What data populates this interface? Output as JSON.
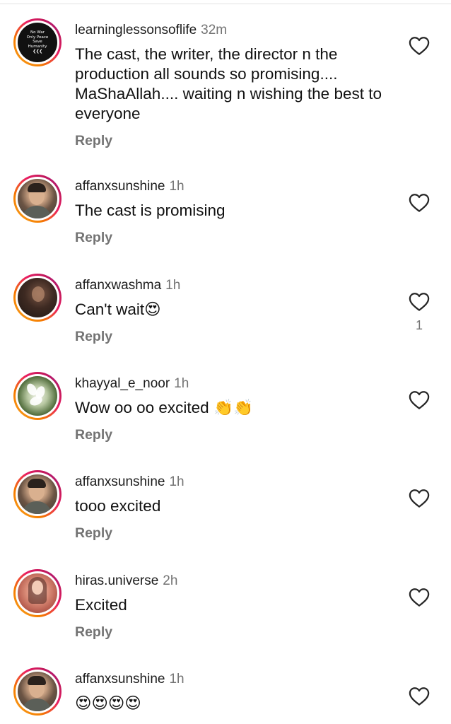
{
  "comments": [
    {
      "username": "learninglessonsoflife",
      "time": "32m",
      "text": "The cast, the writer, the director n the production all sounds so promising.... MaShaAllah.... waiting n wishing the best to everyone",
      "reply": "Reply",
      "avatar": {
        "kind": "text-badge",
        "lines": [
          "No War",
          "Only Peace",
          "Save",
          "Humanity"
        ],
        "mark": "❮❮❮"
      },
      "likes": ""
    },
    {
      "username": "affanxsunshine",
      "time": "1h",
      "text": "The cast is promising",
      "reply": "Reply",
      "likes": ""
    },
    {
      "username": "affanxwashma",
      "time": "1h",
      "text": "Can't wait",
      "emoji": "😍",
      "reply": "Reply",
      "likes": "1"
    },
    {
      "username": "khayyal_e_noor",
      "time": "1h",
      "text": "Wow oo oo excited ",
      "emoji": "👏👏",
      "reply": "Reply",
      "likes": ""
    },
    {
      "username": "affanxsunshine",
      "time": "1h",
      "text": "tooo excited",
      "reply": "Reply",
      "likes": ""
    },
    {
      "username": "hiras.universe",
      "time": "2h",
      "text": "Excited",
      "reply": "Reply",
      "likes": ""
    },
    {
      "username": "affanxsunshine",
      "time": "1h",
      "text": "",
      "emoji": "😍😍😍😍",
      "reply": "",
      "likes": ""
    }
  ],
  "icons": {
    "like": "heart-outline-icon"
  },
  "colors": {
    "text": "#111111",
    "muted": "#737373",
    "ring_start": "#f9a825",
    "ring_end": "#8e24aa"
  }
}
